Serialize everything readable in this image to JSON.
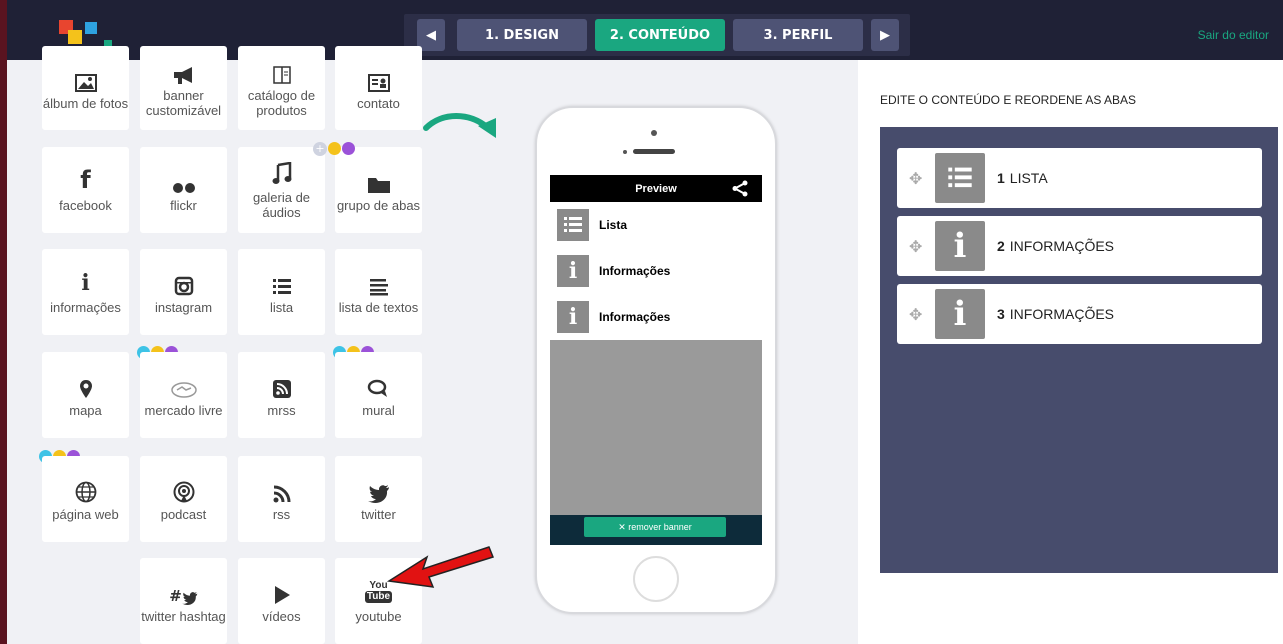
{
  "topbar": {
    "steps": [
      "1. DESIGN",
      "2. CONTEÚDO",
      "3. PERFIL"
    ],
    "active_step": 1,
    "exit_label": "Sair do editor"
  },
  "widgets": [
    {
      "label": "álbum de fotos",
      "icon": "photo-album-icon"
    },
    {
      "label": "banner customizável",
      "icon": "megaphone-icon"
    },
    {
      "label": "catálogo de produtos",
      "icon": "book-icon"
    },
    {
      "label": "contato",
      "icon": "contact-card-icon"
    },
    {
      "label": "facebook",
      "icon": "facebook-icon"
    },
    {
      "label": "flickr",
      "icon": "flickr-icon"
    },
    {
      "label": "galeria de áudios",
      "icon": "music-note-icon"
    },
    {
      "label": "grupo de abas",
      "icon": "folder-icon"
    },
    {
      "label": "informações",
      "icon": "info-icon"
    },
    {
      "label": "instagram",
      "icon": "instagram-icon"
    },
    {
      "label": "lista",
      "icon": "list-icon"
    },
    {
      "label": "lista de textos",
      "icon": "text-list-icon"
    },
    {
      "label": "mapa",
      "icon": "map-pin-icon"
    },
    {
      "label": "mercado livre",
      "icon": "handshake-icon"
    },
    {
      "label": "mrss",
      "icon": "mrss-icon"
    },
    {
      "label": "mural",
      "icon": "chat-bubbles-icon"
    },
    {
      "label": "página web",
      "icon": "globe-icon"
    },
    {
      "label": "podcast",
      "icon": "podcast-icon"
    },
    {
      "label": "rss",
      "icon": "rss-icon"
    },
    {
      "label": "twitter",
      "icon": "twitter-icon"
    },
    {
      "label": "twitter hashtag",
      "icon": "twitter-hashtag-icon"
    },
    {
      "label": "vídeos",
      "icon": "play-icon"
    },
    {
      "label": "youtube",
      "icon": "youtube-icon"
    }
  ],
  "phone": {
    "preview_title": "Preview",
    "items": [
      "Lista",
      "Informações",
      "Informações"
    ],
    "remove_banner": "✕ remover banner"
  },
  "right": {
    "title": "EDITE O CONTEÚDO E REORDENE AS ABAS",
    "tabs": [
      {
        "num": "1",
        "name": "LISTA",
        "icon": "list-icon"
      },
      {
        "num": "2",
        "name": "INFORMAÇÕES",
        "icon": "info-icon"
      },
      {
        "num": "3",
        "name": "INFORMAÇÕES",
        "icon": "info-icon"
      }
    ]
  },
  "colors": {
    "accent": "#1aa780",
    "topbar": "#1f2136",
    "panel": "#474c6c",
    "dot_blue": "#3ec3e6",
    "dot_yellow": "#f4c21b",
    "dot_purple": "#9b52d8",
    "arrow": "#e11212"
  }
}
